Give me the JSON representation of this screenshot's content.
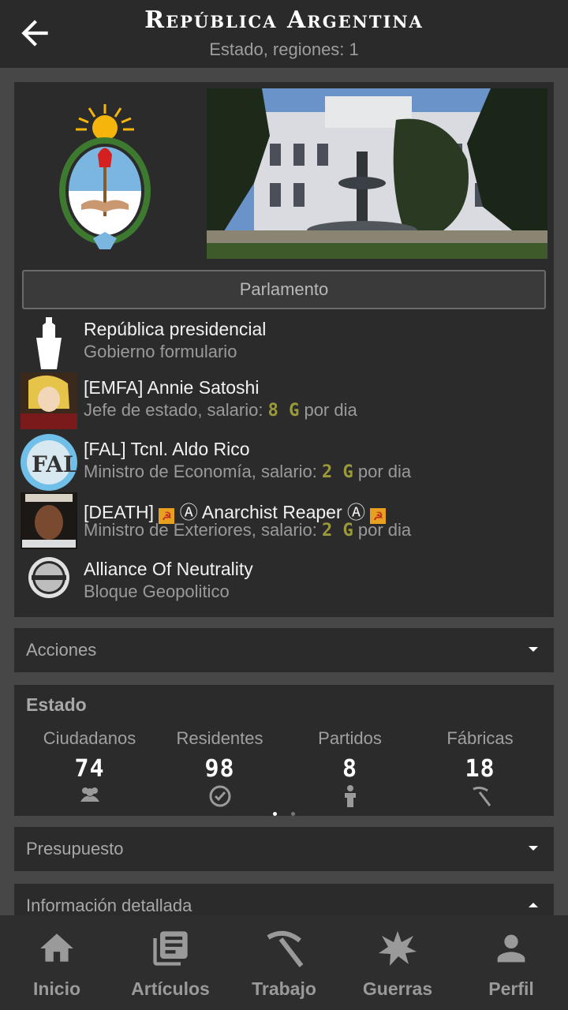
{
  "header": {
    "title": "República Argentina",
    "subtitle": "Estado, regiones: 1"
  },
  "main": {
    "parliament_label": "Parlamento",
    "rows": [
      {
        "line1": "República presidencial",
        "line2": "Gobierno formulario",
        "icon": "podium-icon"
      },
      {
        "line1": "[EMFA] Annie Satoshi",
        "role": "Jefe de estado, salario: ",
        "salary": "8 G",
        "suffix": " por dia",
        "icon": "avatar"
      },
      {
        "line1": "[FAL] Tcnl. Aldo Rico",
        "role": "Ministro de Economía, salario: ",
        "salary": "2 G",
        "suffix": " por dia",
        "icon": "avatar"
      },
      {
        "line1_prefix": "[DEATH] ",
        "line1_name": " Ⓐ Anarchist Reaper Ⓐ",
        "role": "Ministro de Exteriores, salario: ",
        "salary": "2 G",
        "suffix": " por dia",
        "icon": "avatar"
      },
      {
        "line1": "Alliance Of Neutrality",
        "line2": "Bloque Geopolitico",
        "icon": "alliance-logo"
      }
    ]
  },
  "acciones": {
    "label": "Acciones"
  },
  "estado": {
    "title": "Estado",
    "stats": [
      {
        "label": "Ciudadanos",
        "value": "74",
        "icon": "people-icon"
      },
      {
        "label": "Residentes",
        "value": "98",
        "icon": "check-circle-icon"
      },
      {
        "label": "Partidos",
        "value": "8",
        "icon": "person-podium-icon"
      },
      {
        "label": "Fábricas",
        "value": "18",
        "icon": "pickaxe-icon"
      }
    ]
  },
  "presupuesto": {
    "label": "Presupuesto"
  },
  "info": {
    "label": "Información detallada"
  },
  "nav": [
    {
      "label": "Inicio",
      "icon": "home-icon"
    },
    {
      "label": "Artículos",
      "icon": "articles-icon"
    },
    {
      "label": "Trabajo",
      "icon": "pickaxe-icon"
    },
    {
      "label": "Guerras",
      "icon": "explosion-icon"
    },
    {
      "label": "Perfil",
      "icon": "person-icon"
    }
  ]
}
